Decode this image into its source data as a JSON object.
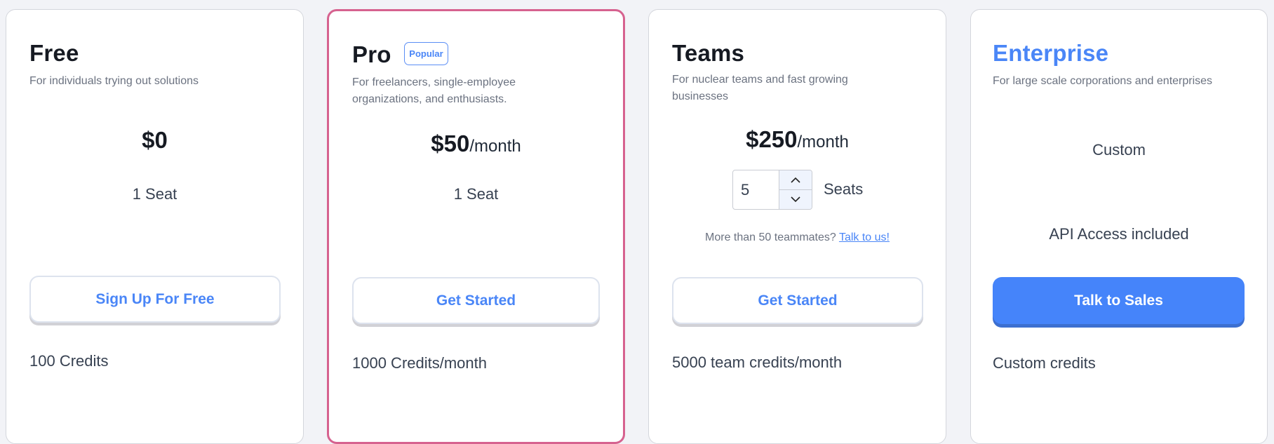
{
  "plans": [
    {
      "name": "Free",
      "description": "For individuals trying out solutions",
      "price": "$0",
      "price_unit": "",
      "seats_label": "1 Seat",
      "button_label": "Sign Up For Free",
      "features": [
        "100 Credits"
      ]
    },
    {
      "name": "Pro",
      "badge": "Popular",
      "description_lines": [
        "For freelancers, single-employee",
        "organizations, and enthusiasts."
      ],
      "price": "$50",
      "price_unit": "/month",
      "seats_label": "1 Seat",
      "button_label": "Get Started",
      "features": [
        "1000 Credits/month"
      ]
    },
    {
      "name": "Teams",
      "description_lines": [
        "For nuclear teams and fast growing",
        "businesses"
      ],
      "price": "$250",
      "price_unit": "/month",
      "seat_stepper": {
        "value": "5",
        "label": "Seats"
      },
      "more_text": "More than 50 teammates?",
      "more_link": "Talk to us!",
      "button_label": "Get Started",
      "features": [
        "5000 team credits/month"
      ]
    },
    {
      "name": "Enterprise",
      "description": "For large scale corporations and enterprises",
      "price": "Custom",
      "api_note": "API Access included",
      "button_label": "Talk to Sales",
      "features": [
        "Custom credits"
      ]
    }
  ],
  "colors": {
    "accent": "#4a86f7",
    "popular_border": "#d6628f",
    "background": "#f2f3f7"
  }
}
